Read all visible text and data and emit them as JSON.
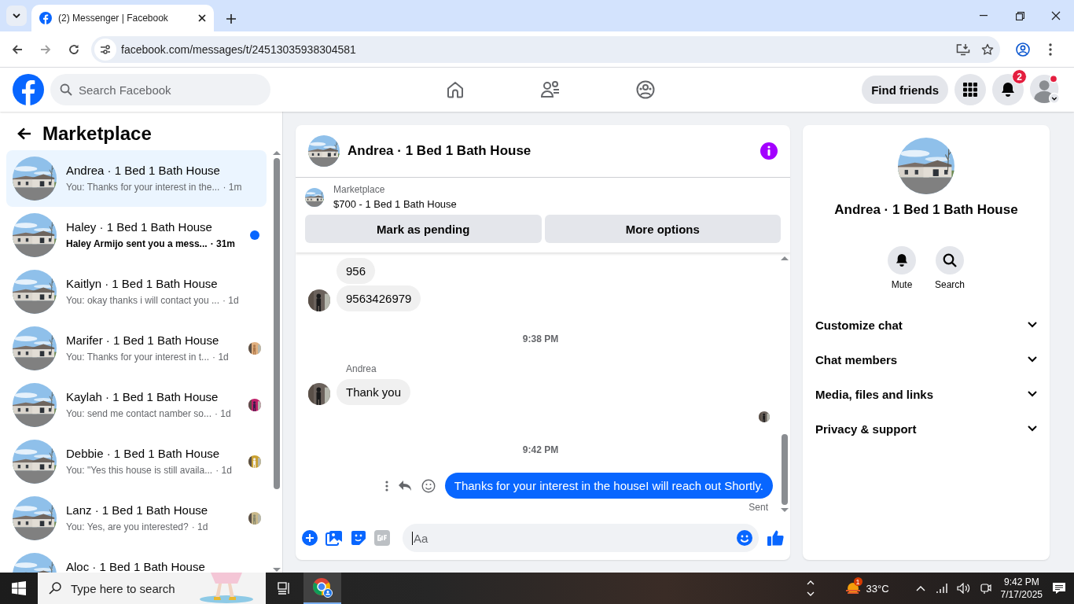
{
  "browser": {
    "tab_title": "(2) Messenger | Facebook",
    "address": "facebook.com/messages/t/24513035938304581"
  },
  "header": {
    "search_placeholder": "Search Facebook",
    "find_friends": "Find friends",
    "notification_count": "2"
  },
  "sidebar": {
    "title": "Marketplace",
    "conversations": [
      {
        "name": "Andrea · 1 Bed 1 Bath House",
        "preview": "You: Thanks for your interest in the...",
        "time": "· 1m",
        "selected": true,
        "unread": false,
        "seen": false
      },
      {
        "name": "Haley · 1 Bed 1 Bath House",
        "preview": "Haley Armijo sent you a mess...",
        "time": "· 31m",
        "selected": false,
        "unread": true,
        "seen": false
      },
      {
        "name": "Kaitlyn · 1 Bed 1 Bath House",
        "preview": "You: okay thanks i will contact you ...",
        "time": "· 1d",
        "selected": false,
        "unread": false,
        "seen": false
      },
      {
        "name": "Marifer · 1 Bed 1 Bath House",
        "preview": "You: Thanks for your interest in t...",
        "time": "· 1d",
        "selected": false,
        "unread": false,
        "seen": true
      },
      {
        "name": "Kaylah · 1 Bed 1 Bath House",
        "preview": "You: send me contact namber so...",
        "time": "· 1d",
        "selected": false,
        "unread": false,
        "seen": true
      },
      {
        "name": "Debbie · 1 Bed 1 Bath House",
        "preview": "You: \"Yes this house is still availa...",
        "time": "· 1d",
        "selected": false,
        "unread": false,
        "seen": true
      },
      {
        "name": "Lanz · 1 Bed 1 Bath House",
        "preview": "You: Yes, are you interested?",
        "time": "· 1d",
        "selected": false,
        "unread": false,
        "seen": true
      },
      {
        "name": "Aloc · 1 Bed 1 Bath House",
        "selected": false,
        "unread": false,
        "seen": false
      }
    ]
  },
  "chat": {
    "title": "Andrea · 1 Bed 1 Bath House",
    "listing": {
      "label": "Marketplace",
      "title": "$700 - 1 Bed 1 Bath House"
    },
    "buttons": [
      "Mark as pending",
      "More options"
    ],
    "messages": [
      {
        "kind": "incoming",
        "text": "956",
        "avatar": false
      },
      {
        "kind": "incoming",
        "text": "9563426979",
        "avatar": true
      },
      {
        "kind": "timestamp",
        "text": "9:38 PM"
      },
      {
        "kind": "incoming",
        "sender": "Andrea",
        "text": "Thank you",
        "avatar": true
      },
      {
        "kind": "receipt"
      },
      {
        "kind": "timestamp",
        "text": "9:42 PM"
      },
      {
        "kind": "outgoing",
        "text": "Thanks for your interest in the houseI will reach out Shortly.",
        "status": "Sent"
      }
    ],
    "composer_placeholder": "Aa"
  },
  "details": {
    "title": "Andrea · 1 Bed 1 Bath House",
    "actions": [
      {
        "kind": "mute",
        "label": "Mute"
      },
      {
        "kind": "search",
        "label": "Search"
      }
    ],
    "sections": [
      {
        "label": "Customize chat",
        "expanded": false
      },
      {
        "label": "Chat members",
        "expanded": false
      },
      {
        "label": "Media, files and links",
        "expanded": false
      },
      {
        "label": "Privacy & support",
        "expanded": false
      }
    ]
  },
  "taskbar": {
    "search_placeholder": "Type here to search",
    "weather_badge": "1",
    "temperature": "33°C",
    "time": "9:42 PM",
    "date": "7/17/2025"
  }
}
